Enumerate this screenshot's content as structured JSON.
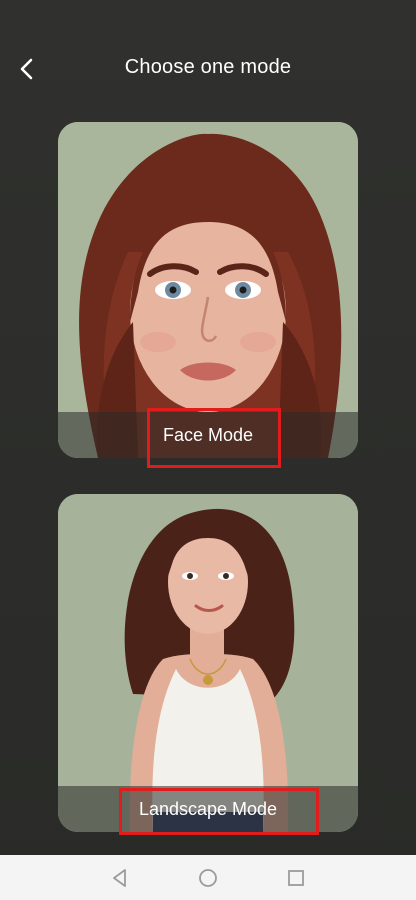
{
  "header": {
    "title": "Choose one mode",
    "back_icon": "chevron-left-icon"
  },
  "modes": [
    {
      "label": "Face Mode",
      "image": "portrait-face-cartoon-image",
      "highlighted": true
    },
    {
      "label": "Landscape Mode",
      "image": "portrait-full-body-cartoon-image",
      "highlighted": true
    }
  ],
  "navbar": {
    "back_icon": "triangle-back-icon",
    "home_icon": "circle-home-icon",
    "recents_icon": "square-recents-icon"
  },
  "colors": {
    "background": "#2c2d2a",
    "highlight": "#e01c1c",
    "card_bg": "#a9b59a",
    "navbar": "#f4f4f4"
  }
}
